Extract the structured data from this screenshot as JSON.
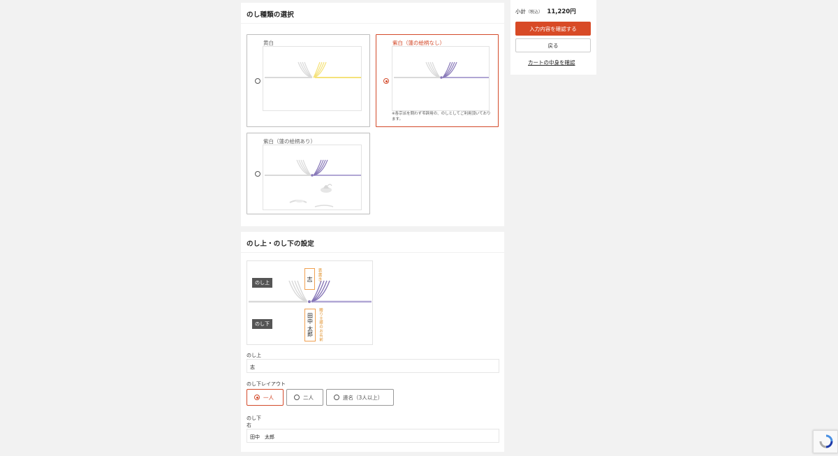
{
  "noshi_type_section": {
    "title": "のし種類の選択",
    "options": [
      {
        "label": "黄白",
        "selected": false
      },
      {
        "label": "紫白（蓮の絵柄なし）",
        "selected": true,
        "note": "※各宗派を問わず弔辞用の、のしとしてご利用頂いております。"
      },
      {
        "label": "紫白（蓮の絵柄あり）",
        "selected": false
      }
    ]
  },
  "settings_section": {
    "title": "のし上・のし下の設定",
    "preview": {
      "upper_tag": "のし上",
      "lower_tag": "のし下",
      "upper_text": "志",
      "upper_note": "表書き",
      "lower_text": "田中 太郎",
      "lower_note": "贈り主様のお名前"
    },
    "noshi_upper": {
      "label": "のし上",
      "value": "志"
    },
    "layout": {
      "label": "のし下レイアウト",
      "options": [
        {
          "label": "一人",
          "selected": true
        },
        {
          "label": "二人",
          "selected": false
        },
        {
          "label": "連名（3人以上）",
          "selected": false
        }
      ]
    },
    "noshi_lower": {
      "label": "のし下",
      "sub_label": "右",
      "value": "田中　太郎"
    }
  },
  "sidebar": {
    "subtotal_label": "小計",
    "tax_label": "（税込）",
    "subtotal_value": "11,220円",
    "confirm_button": "入力内容を確認する",
    "back_button": "戻る",
    "cart_link": "カートの中身を確認"
  },
  "colors": {
    "accent": "#d84a26",
    "yellow_cord": "#f5e27a",
    "purple_cord": "#8878b8",
    "note_orange": "#e0902a"
  }
}
